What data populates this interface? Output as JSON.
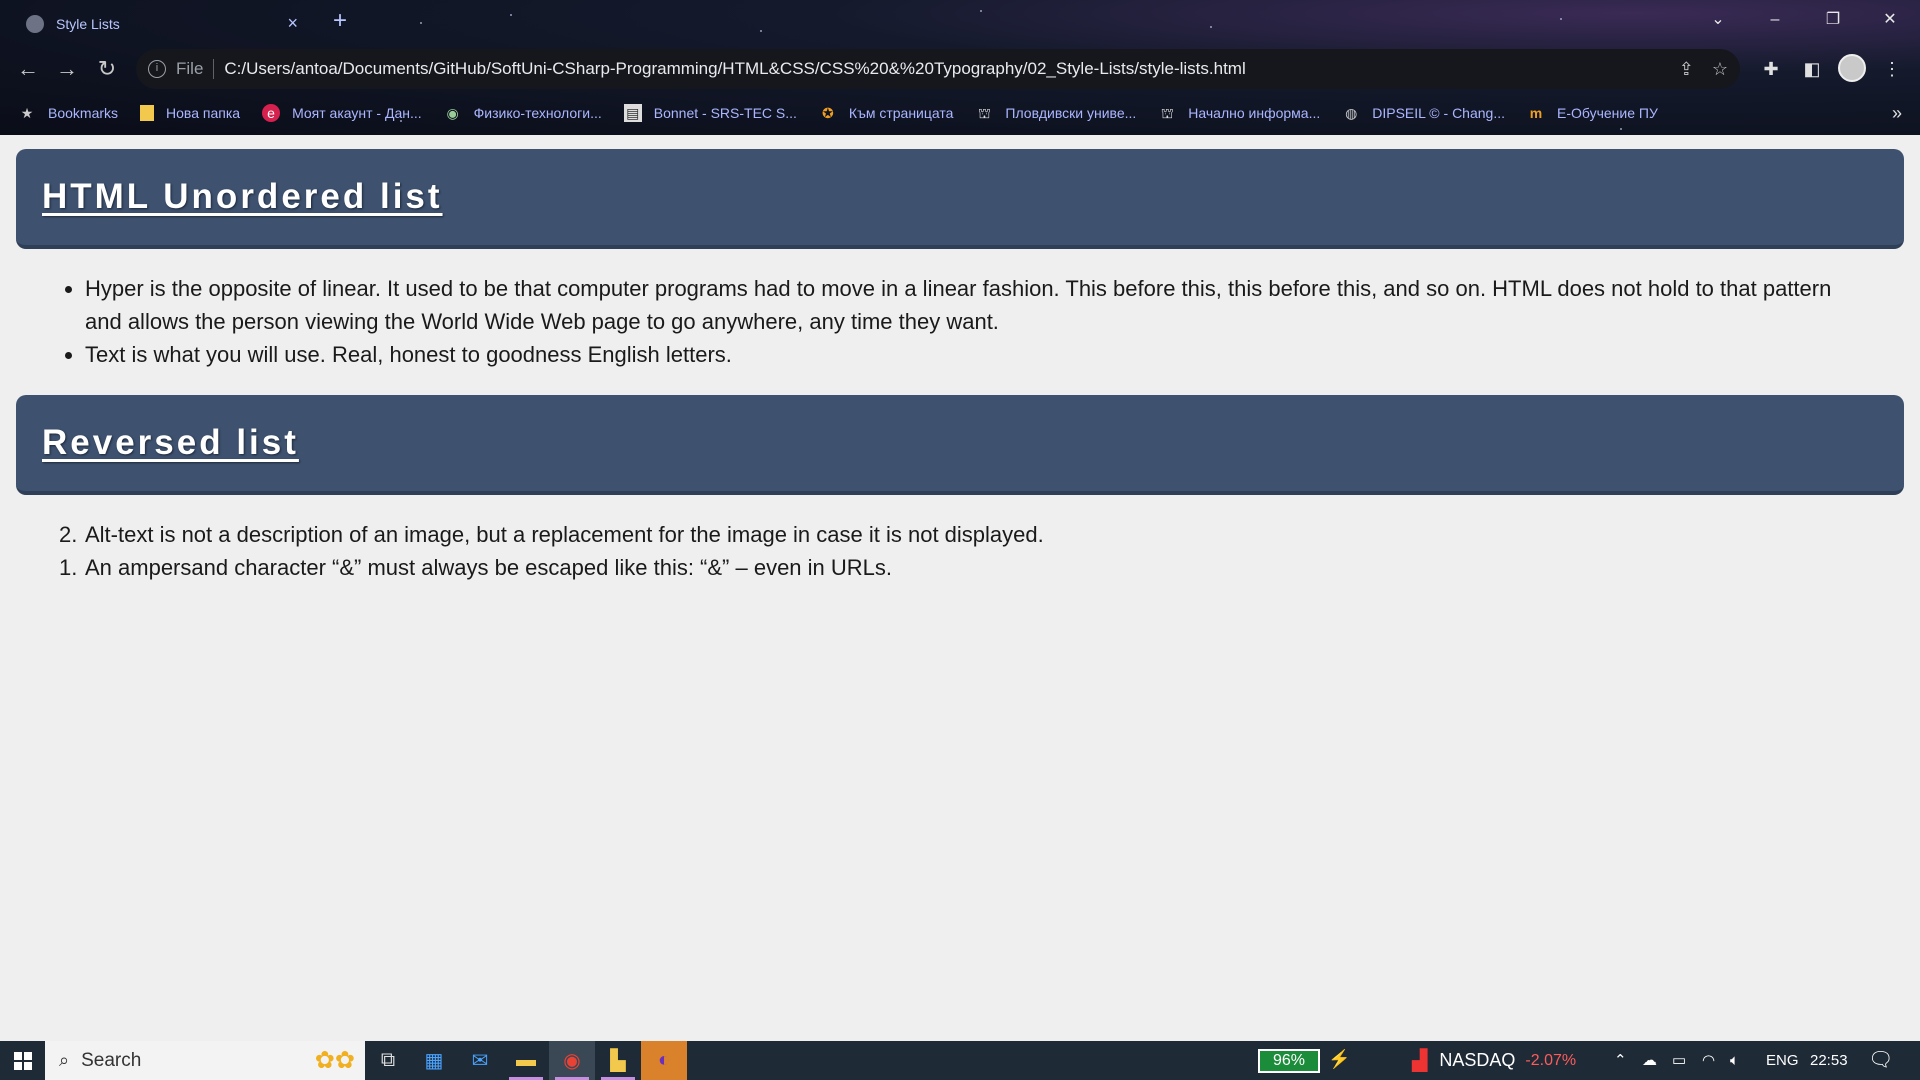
{
  "browser": {
    "tab_title": "Style Lists",
    "tab_close": "×",
    "new_tab": "+",
    "scheme": "File",
    "url": "C:/Users/antoa/Documents/GitHub/SoftUni-CSharp-Programming/HTML&CSS/CSS%20&%20Typography/02_Style-Lists/style-lists.html",
    "bookmarks": [
      {
        "label": "Bookmarks",
        "icon": "star-icon"
      },
      {
        "label": "Нова папка",
        "icon": "folder-icon"
      },
      {
        "label": "Моят акаунт - Дан...",
        "icon": "e-icon"
      },
      {
        "label": "Физико-технологи...",
        "icon": "globe-icon"
      },
      {
        "label": "Bonnet - SRS-TEC S...",
        "icon": "page-icon"
      },
      {
        "label": "Към страницата",
        "icon": "arrow-icon"
      },
      {
        "label": "Пловдивски униве...",
        "icon": "university-icon"
      },
      {
        "label": "Начално информа...",
        "icon": "university-icon"
      },
      {
        "label": "DIPSEIL © - Chang...",
        "icon": "globe-icon"
      },
      {
        "label": "Е-Обучение ПУ",
        "icon": "m-icon"
      }
    ],
    "bookmarks_more": "»"
  },
  "page": {
    "heading1": "HTML Unordered list",
    "unordered": [
      "Hyper is the opposite of linear. It used to be that computer programs had to move in a linear fashion. This before this, this before this, and so on. HTML does not hold to that pattern and allows the person viewing the World Wide Web page to go anywhere, any time they want.",
      "Text is what you will use. Real, honest to goodness English letters."
    ],
    "heading2": "Reversed list",
    "ordered": [
      {
        "num": "2.",
        "text": "Alt-text is not a description of an image, but a replacement for the image in case it is not displayed."
      },
      {
        "num": "1.",
        "text": "An ampersand character “&” must always be escaped like this: “&” – even in URLs."
      }
    ]
  },
  "taskbar": {
    "search_label": "Search",
    "battery": "96%",
    "ticker": "NASDAQ",
    "ticker_change": "-2.07%",
    "language": "ENG",
    "time": "22:53"
  },
  "colors": {
    "header_bg": "#3e5270",
    "page_bg": "#efefef",
    "taskbar_bg": "#1e2a36",
    "battery_green": "#1b8c3a",
    "ticker_red": "#ff5b5b"
  }
}
